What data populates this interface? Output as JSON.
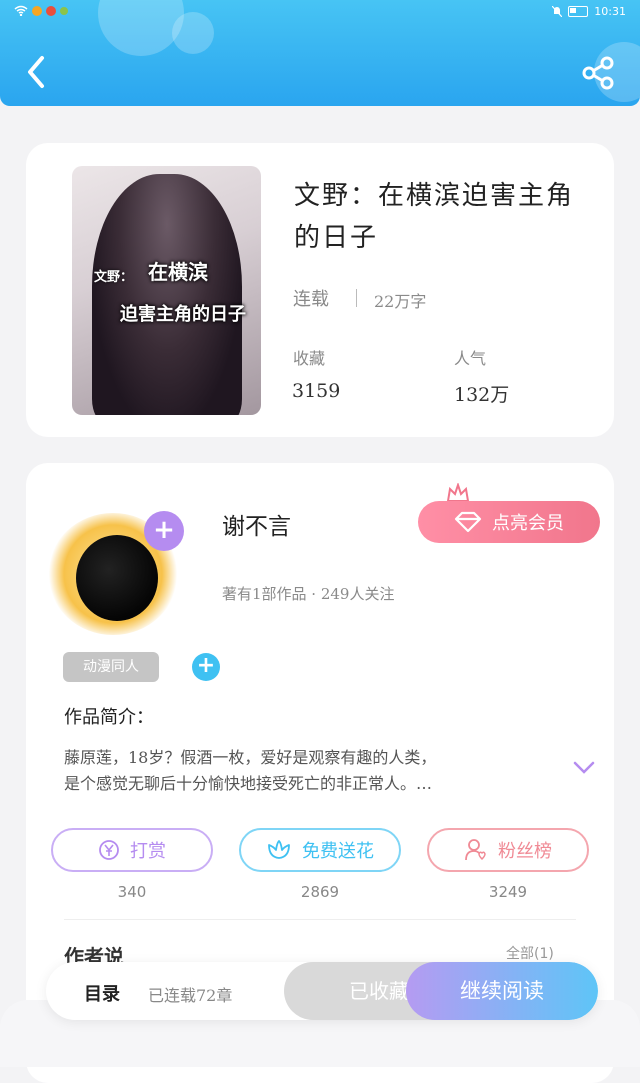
{
  "status_bar": {
    "time": "10:31"
  },
  "colors": {
    "header": "#2aa5ef",
    "accent_purple": "#b58cf0",
    "accent_blue": "#3fc1f2",
    "vip_pink": "#f1768c"
  },
  "header": {
    "back_icon": "chevron-left-icon",
    "share_icon": "share-icon"
  },
  "book": {
    "cover_title_line1": "在横滨",
    "cover_title_small": "文野：",
    "cover_title_line2": "迫害主角的日子",
    "title": "文野：在横滨迫害主角的日子",
    "status": "连载",
    "words": "22万字",
    "collect_label": "收藏",
    "collect_value": "3159",
    "popularity_label": "人气",
    "popularity_value": "132万"
  },
  "author": {
    "name": "谢不言",
    "vip_button": "点亮会员",
    "meta": "著有1部作品 · 249人关注",
    "tag": "动漫同人",
    "intro_title": "作品简介：",
    "intro_line1": "藤原莲，18岁？假酒一枚，爱好是观察有趣的人类，",
    "intro_line2": "是个感觉无聊后十分愉快地接受死亡的非正常人。…"
  },
  "actions": [
    {
      "label": "打赏",
      "count": "340",
      "icon": "yen-icon",
      "color": "#b58cf0"
    },
    {
      "label": "免费送花",
      "count": "2869",
      "icon": "flower-icon",
      "color": "#3fc1f2"
    },
    {
      "label": "粉丝榜",
      "count": "3249",
      "icon": "fans-icon",
      "color": "#f08a95"
    }
  ],
  "partial_section": {
    "title": "作者说",
    "right": "全部(1)"
  },
  "bottom_bar": {
    "toc": "目录",
    "chapters": "已连载72章",
    "collected": "已收藏",
    "continue": "继续阅读"
  }
}
